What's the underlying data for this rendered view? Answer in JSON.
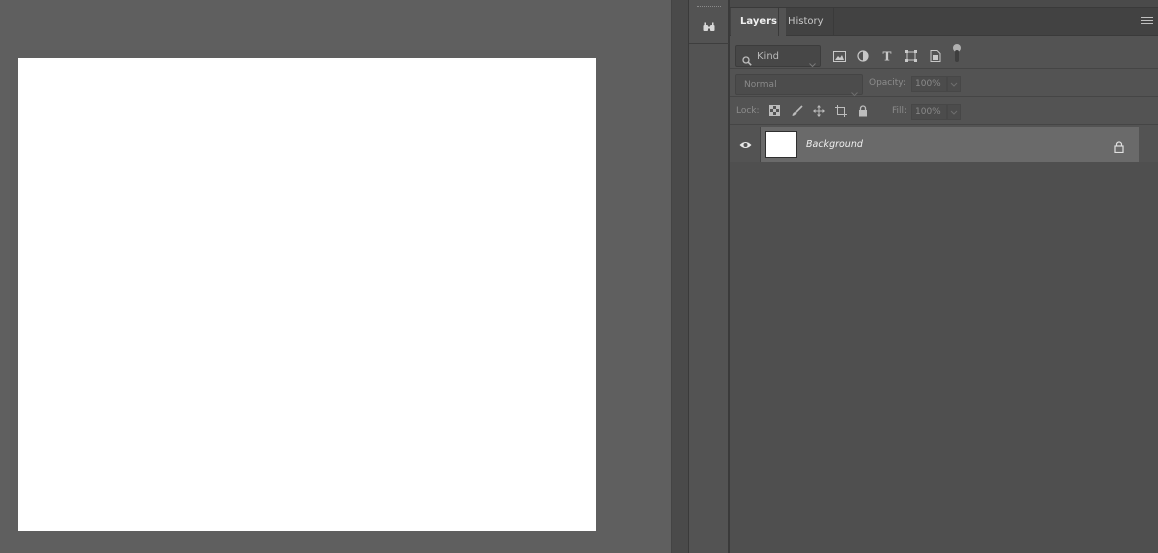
{
  "workspace": {
    "canvas_color": "#ffffff",
    "background_color": "#5f5f5f"
  },
  "dock": {
    "icon": "glasses-icon"
  },
  "panel": {
    "tabs": [
      {
        "label": "Layers",
        "active": true
      },
      {
        "label": "History",
        "active": false
      }
    ],
    "filter": {
      "kind_label": "Kind",
      "icons": [
        "pixel-layer-filter-icon",
        "adjustment-layer-filter-icon",
        "type-layer-filter-icon",
        "shape-layer-filter-icon",
        "smart-object-filter-icon"
      ]
    },
    "blend_mode": "Normal",
    "opacity_label": "Opacity:",
    "opacity_value": "100%",
    "lock_label": "Lock:",
    "fill_label": "Fill:",
    "fill_value": "100%",
    "layers": [
      {
        "name": "Background",
        "visible": true,
        "locked": true,
        "thumbnail_color": "#ffffff"
      }
    ]
  }
}
